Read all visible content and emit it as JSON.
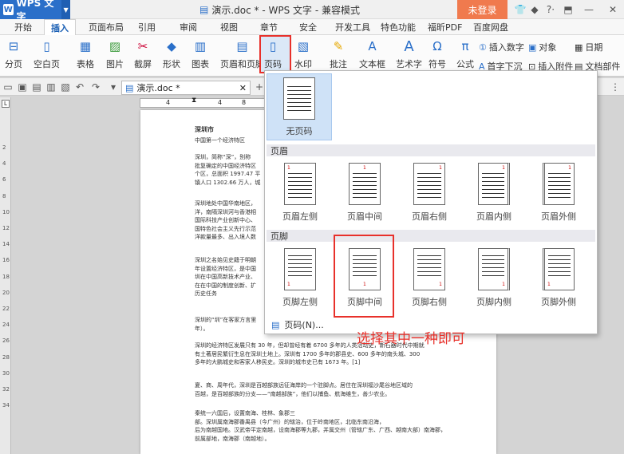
{
  "title": {
    "app_name": "WPS 文字",
    "doc_title": "演示.doc * - WPS 文字 - 兼容模式",
    "login": "未登录"
  },
  "menu": [
    "开始",
    "插入",
    "页面布局",
    "引用",
    "审阅",
    "视图",
    "章节",
    "安全",
    "开发工具",
    "特色功能",
    "福昕PDF",
    "百度网盘"
  ],
  "ribbon": {
    "fenye": "分页",
    "kongbaiye": "空白页",
    "biaoge": "表格",
    "tupian": "图片",
    "jietu": "截屏",
    "xingzhuang": "形状",
    "tubiao": "图表",
    "yemeiyejiao": "页眉和页脚",
    "yema": "页码",
    "shuiyin": "水印",
    "pizhu": "批注",
    "wenbenkuang": "文本框",
    "yishuzi": "艺术字",
    "fuhao": "符号",
    "gongshi": "公式",
    "charu_shuzi": "插入数字",
    "duixiang": "对象",
    "riqi": "日期",
    "shouzixiachen": "首字下沉",
    "charu_fujian": "插入附件",
    "wendangbujian": "文档部件"
  },
  "doc_tab": "演示.doc *",
  "ruler": [
    "4",
    "4",
    "8"
  ],
  "vruler": [
    "2",
    "4",
    "6",
    "8",
    "10",
    "12",
    "14",
    "16",
    "18",
    "20",
    "22",
    "24",
    "26",
    "28",
    "30",
    "32",
    "34"
  ],
  "document": {
    "heading": "深圳市",
    "subheading": "中国第一个经济特区",
    "paragraphs": [
      "深圳，简称“深”，别称\n批复确定的中国经济特区\n个区，总面积 1997.47 平\n镇人口 1302.66 万人，城",
      "深圳地处中国华南地区，\n洋，南隔深圳河与香港相\n国际科技产业创新中心、\n国特色社会主义先行示范\n洋款量最多、出入境人数",
      "深圳之名始见史籍于明朝\n年设置经济特区，是中国\n圳在中国高新技术产业、\n在在中国的制度创新、扩\n历史任务",
      "深圳的“圳”在客家方言里\n年）。",
      "深圳的经济特区发展只有 30 年，但却曾经有着 6700 多年的人类活动史，新石器时代中期就\n有土著居民繁衍生息在深圳土地上。深圳有 1700 多年的郡县史、600 多年的南头城、300\n多年的大鹏城史和客家人移民史。深圳的城市史已有 1673 年。[1]",
      "夏、商、周年代，深圳是百越部族远征海岸的一个驻脚点。居住在深圳福沙尾谷地区域的\n百越，是百越部族的分支——“南越部族”，他们以捕鱼、航海维生，善少农业。",
      "秦统一六国后，设置南海、桂林、象郡三\n部。深圳属南海郡番禺县（今广州）的辖治，位于岭南地区，北临东南沿海，\n后为南越国地。汉武帝平定南越，设南海郡等九郡，并属交州（管辖广东、广西、越南大部）南海郡，\n前属部地，南海郡（南越地）。"
    ]
  },
  "dropdown": {
    "none_label": "无页码",
    "header_section": "页眉",
    "footer_section": "页脚",
    "header_options": [
      "页眉左侧",
      "页眉中间",
      "页眉右侧",
      "页眉内侧",
      "页眉外侧"
    ],
    "footer_options": [
      "页脚左侧",
      "页脚中间",
      "页脚右侧",
      "页脚内侧",
      "页脚外侧"
    ],
    "thumb_number": "1",
    "more": "页码(N)..."
  },
  "annotation": "选择其中一种即可",
  "colors": {
    "accent": "#2a6fc9",
    "highlight_red": "#e8312b",
    "login_bg": "#f07a4e"
  }
}
